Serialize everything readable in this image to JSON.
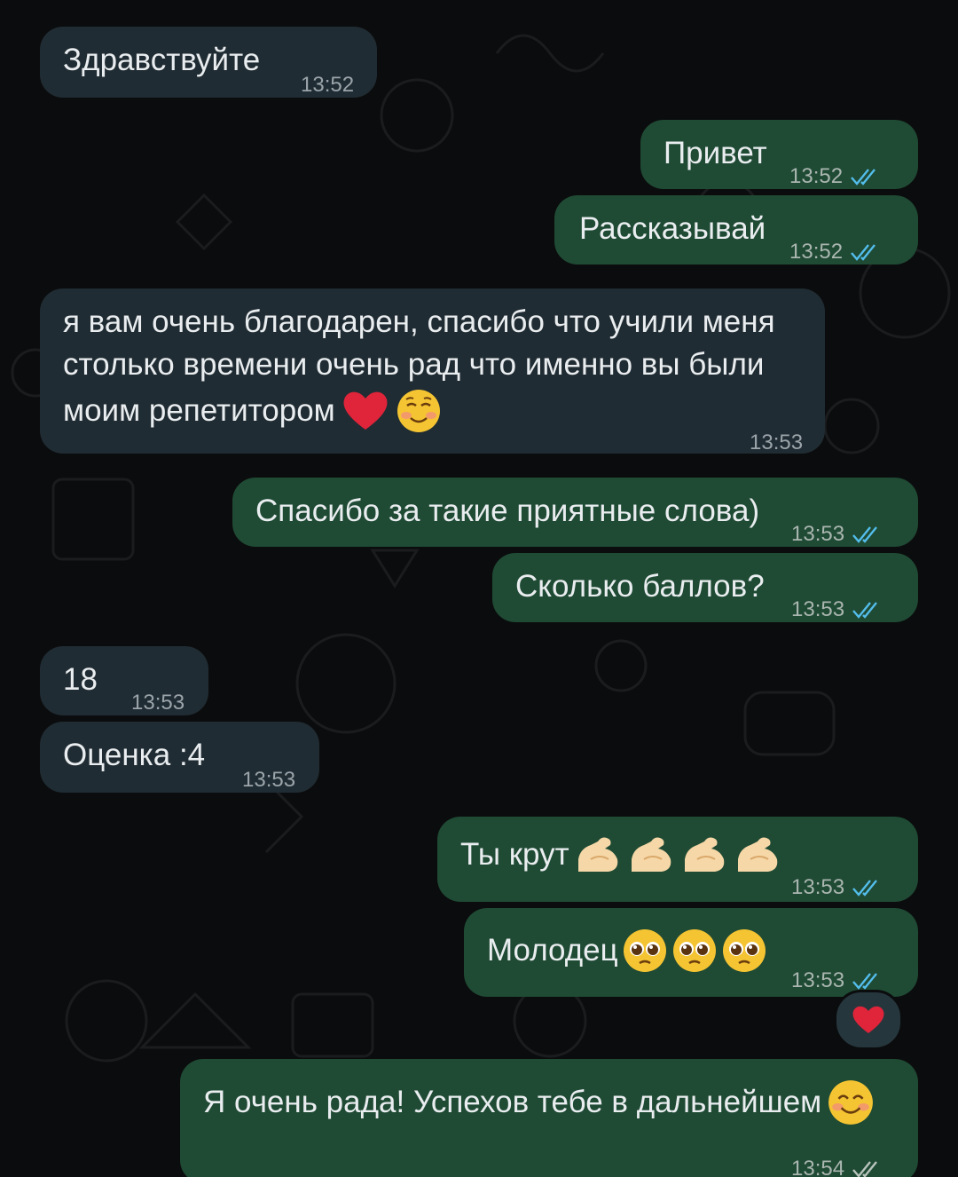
{
  "messages": [
    {
      "dir": "in",
      "text": "Здравствуйте",
      "time": "13:52"
    },
    {
      "dir": "out",
      "text": "Привет",
      "time": "13:52"
    },
    {
      "dir": "out",
      "text": "Рассказывай",
      "time": "13:52"
    },
    {
      "dir": "in",
      "lines": [
        "я вам очень благодарен, спасибо что учили меня",
        "столько времени очень рад что именно вы были",
        "моим репетитором"
      ],
      "emoji": [
        "red-heart",
        "smiling-face"
      ],
      "time": "13:53"
    },
    {
      "dir": "out",
      "text": "Спасибо за такие приятные слова)",
      "time": "13:53"
    },
    {
      "dir": "out",
      "text": "Сколько баллов?",
      "time": "13:53"
    },
    {
      "dir": "in",
      "text": "18",
      "time": "13:53"
    },
    {
      "dir": "in",
      "text": "Оценка :4",
      "time": "13:53"
    },
    {
      "dir": "out",
      "text": "Ты крут",
      "emoji": [
        "flexed-biceps",
        "flexed-biceps",
        "flexed-biceps",
        "flexed-biceps"
      ],
      "time": "13:53"
    },
    {
      "dir": "out",
      "text": "Молодец",
      "emoji": [
        "pleading-face",
        "pleading-face",
        "pleading-face"
      ],
      "time": "13:53"
    },
    {
      "dir": "out",
      "text": "Я очень рада! Успехов тебе в дальнейшем",
      "emoji": [
        "smiling-eyes-face"
      ],
      "time": "13:54",
      "reaction": "red-heart"
    }
  ],
  "colors": {
    "background": "#0b0c0d",
    "incoming_bubble": "#202c33",
    "outgoing_bubble": "#1f4a34",
    "read_check": "#53bdeb",
    "heart": "#e0243a"
  }
}
